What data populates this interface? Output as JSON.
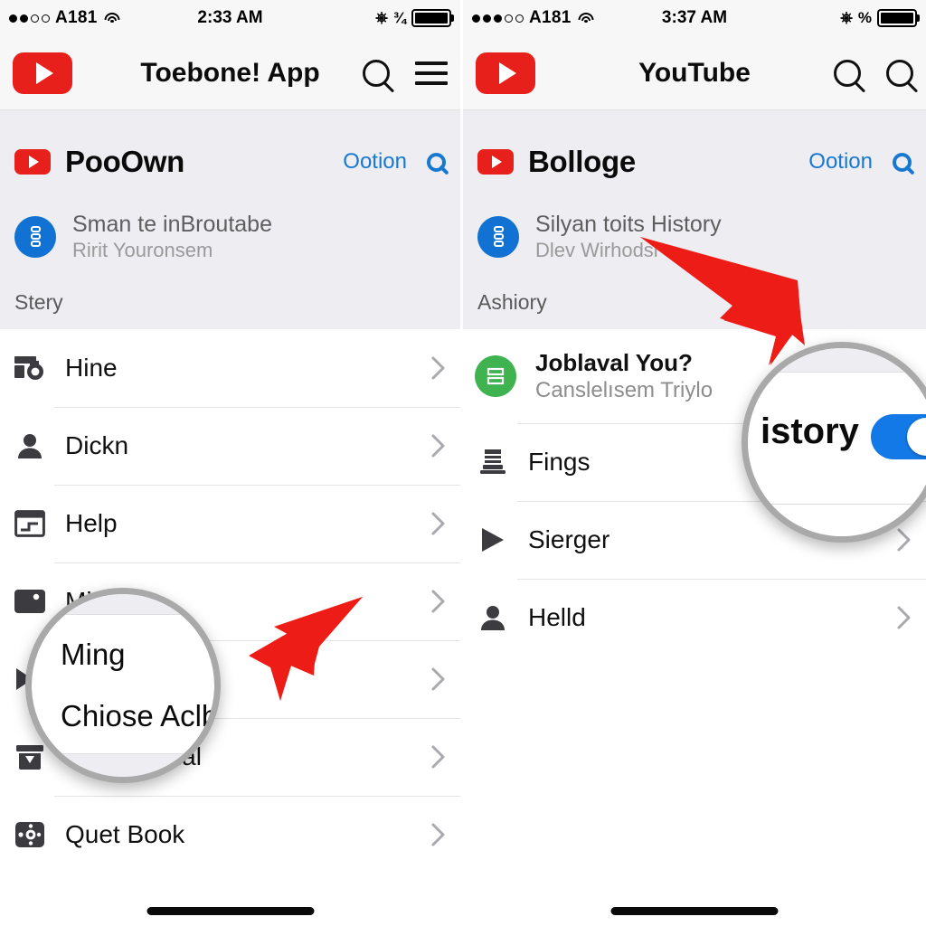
{
  "left_panel": {
    "status_bar": {
      "signal_dots": [
        true,
        true,
        false,
        false
      ],
      "carrier": "A181",
      "wifi_icon": "wifi-icon",
      "time": "2:33 AM",
      "alarm_icon": "alarm-icon",
      "battery_percent_glyph": "¾",
      "battery_icon": "battery-icon"
    },
    "app_bar": {
      "logo_icon": "youtube-logo",
      "title": "Toebone! App",
      "search_icon": "search-icon",
      "menu_icon": "hamburger-menu-icon"
    },
    "account": {
      "logo_icon": "youtube-logo-small",
      "name": "PooOwn",
      "option_link": "Ootion",
      "search_icon": "search-icon",
      "avatar_icon": "account-avatar-icon",
      "title": "Sman te inBroutabe",
      "subtitle": "Ririt Youronsem"
    },
    "section_header": "Stery",
    "items": [
      {
        "icon": "history-card-icon",
        "label": "Hine",
        "chevron": "chevron-right-icon"
      },
      {
        "icon": "person-icon",
        "label": "Dickn",
        "chevron": "chevron-right-icon"
      },
      {
        "icon": "window-card-icon",
        "label": "Help",
        "chevron": "chevron-right-icon"
      },
      {
        "icon": "tv-icon",
        "label": "Ming",
        "chevron": "chevron-right-icon"
      },
      {
        "icon": "video-play-icon",
        "label": "Chiose Aclbe",
        "chevron": "chevron-right-icon"
      },
      {
        "icon": "archive-box-icon",
        "label": "Distlastional",
        "chevron": "chevron-right-icon"
      },
      {
        "icon": "settings-gear-icon",
        "label": "Quet Book",
        "chevron": "chevron-right-icon"
      }
    ],
    "magnifier": {
      "line_1": "Ming",
      "line_2": "Chiose Aclbe"
    },
    "home_indicator": "home-indicator"
  },
  "right_panel": {
    "status_bar": {
      "signal_dots": [
        true,
        true,
        true,
        false,
        false
      ],
      "carrier": "A181",
      "wifi_icon": "wifi-icon",
      "time": "3:37 AM",
      "alarm_icon": "alarm-icon",
      "battery_percent_glyph": "%",
      "battery_icon": "battery-icon"
    },
    "app_bar": {
      "logo_icon": "youtube-logo",
      "title": "YouTube",
      "search_icon": "search-icon",
      "search_icon_2": "search-icon"
    },
    "account": {
      "logo_icon": "youtube-logo-small",
      "name": "Bolloge",
      "option_link": "Ootion",
      "search_icon": "search-icon",
      "avatar_icon": "account-avatar-icon",
      "title": "Silyan toits History",
      "subtitle": "Dlev Wirhodsi"
    },
    "section_header": "Ashiory",
    "toggle_row": {
      "icon": "green-list-icon",
      "title": "Joblaval You?",
      "subtitle": "Canslelısem Triylo"
    },
    "items": [
      {
        "icon": "printer-icon",
        "label": "Fings",
        "chevron": "chevron-right-icon"
      },
      {
        "icon": "play-icon",
        "label": "Sierger",
        "chevron": "chevron-right-icon"
      },
      {
        "icon": "person-icon",
        "label": "Helld",
        "chevron": "chevron-right-icon"
      }
    ],
    "magnifier": {
      "line_1": "istory",
      "toggle_state": "on"
    },
    "home_indicator": "home-indicator"
  },
  "colors": {
    "brand_red": "#e8201c",
    "link_blue": "#1878d0",
    "toggle_blue": "#1279e6",
    "avatar_blue": "#1172d4",
    "green": "#3fb34f",
    "arrow_red": "#ed1c17",
    "panel_gray": "#eeeef2"
  }
}
